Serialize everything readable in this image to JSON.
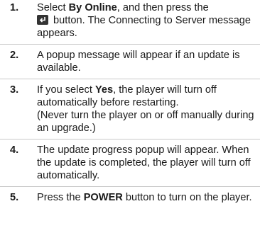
{
  "steps": [
    {
      "number": "1.",
      "parts": {
        "a": "Select ",
        "b_bold": "By Online",
        "c": ", and then press the",
        "icon": "enter-button-icon",
        "d": " button. The Connecting to Server message appears."
      }
    },
    {
      "number": "2.",
      "text": "A popup message will appear if an update is available."
    },
    {
      "number": "3.",
      "parts": {
        "a": "If you select ",
        "b_bold": "Yes",
        "c": ", the player will turn off automatically before restarting.",
        "note": "(Never turn the player on or off manually during an upgrade.)"
      }
    },
    {
      "number": "4.",
      "text": "The update progress popup will appear. When the update is completed, the player will turn off automatically."
    },
    {
      "number": "5.",
      "parts": {
        "a": "Press the ",
        "b_bold": "POWER",
        "c": " button to turn on the player."
      }
    }
  ]
}
